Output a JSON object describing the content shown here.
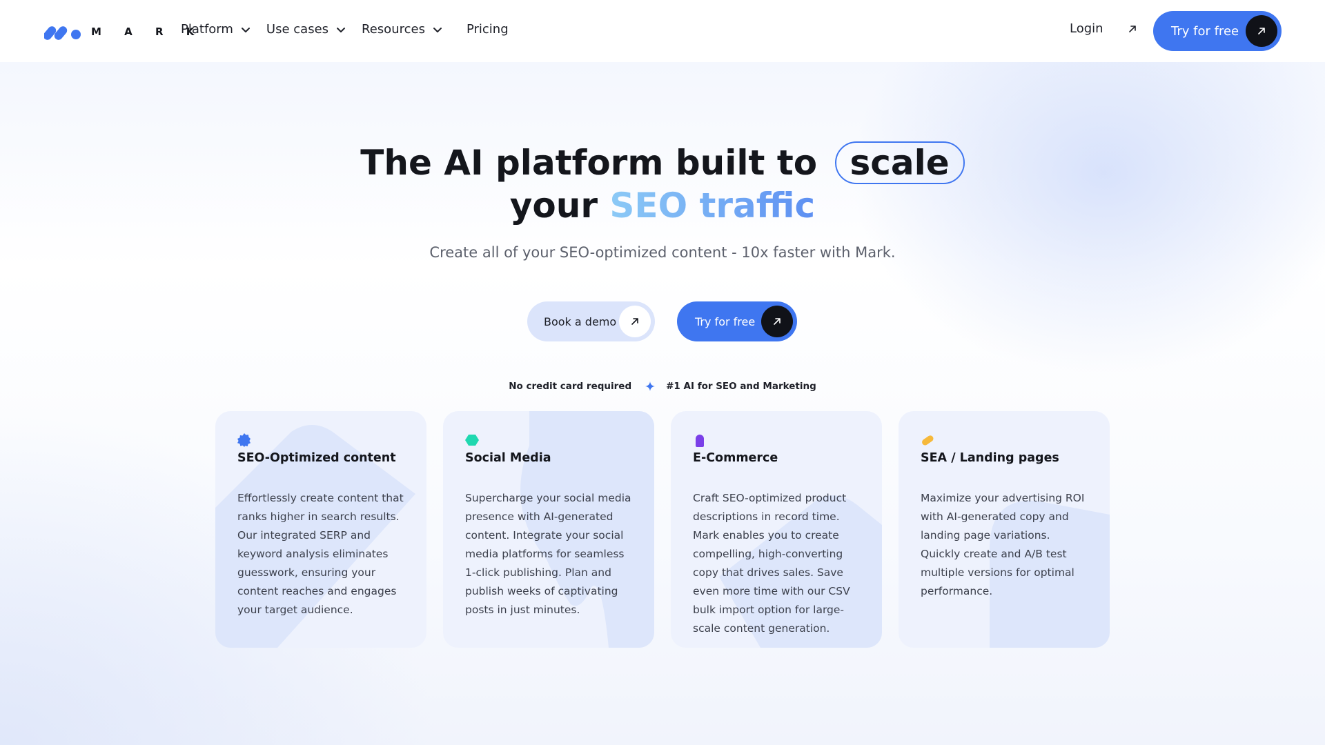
{
  "header": {
    "logo_text": "M A R K",
    "nav": [
      {
        "label": "Platform",
        "has_dropdown": true
      },
      {
        "label": "Use cases",
        "has_dropdown": true
      },
      {
        "label": "Resources",
        "has_dropdown": true
      },
      {
        "label": "Pricing",
        "has_dropdown": false
      }
    ],
    "login_label": "Login",
    "cta_label": "Try for free"
  },
  "hero": {
    "title_part1": "The AI platform built to",
    "title_highlight": "scale",
    "title_part2": "your",
    "title_gradient": "SEO traffic",
    "subtitle": "Create all of your SEO-optimized content - 10x faster with Mark.",
    "book_demo_label": "Book a demo",
    "try_free_label": "Try for free",
    "badge_1": "No credit card required",
    "badge_2": "#1 AI for SEO and Marketing"
  },
  "cards": [
    {
      "icon": "badge-icon",
      "icon_color": "#3f76f0",
      "title": "SEO-Optimized content",
      "description": "Effortlessly create content that ranks higher in search results. Our integrated SERP and keyword analysis eliminates guesswork, ensuring your content reaches and engages your target audience."
    },
    {
      "icon": "hexagon-icon",
      "icon_color": "#1fd8b0",
      "title": "Social Media",
      "description": "Supercharge your social media presence with AI-generated content. Integrate your social media platforms for seamless 1-click publishing. Plan and publish weeks of captivating posts in just minutes."
    },
    {
      "icon": "tag-icon",
      "icon_color": "#7a3fe8",
      "title": "E-Commerce",
      "description": "Craft SEO-optimized product descriptions in record time. Mark enables you to create compelling, high-converting copy that drives sales. Save even more time with our CSV bulk import option for large-scale content generation."
    },
    {
      "icon": "pill-icon",
      "icon_color": "#f6b93b",
      "title": "SEA / Landing pages",
      "description": "Maximize your advertising ROI with AI-generated copy and landing page variations. Quickly create and A/B test multiple versions for optimal performance."
    }
  ],
  "colors": {
    "accent": "#3f76f0",
    "dark": "#101218",
    "card_bg": "#eef2fd"
  }
}
